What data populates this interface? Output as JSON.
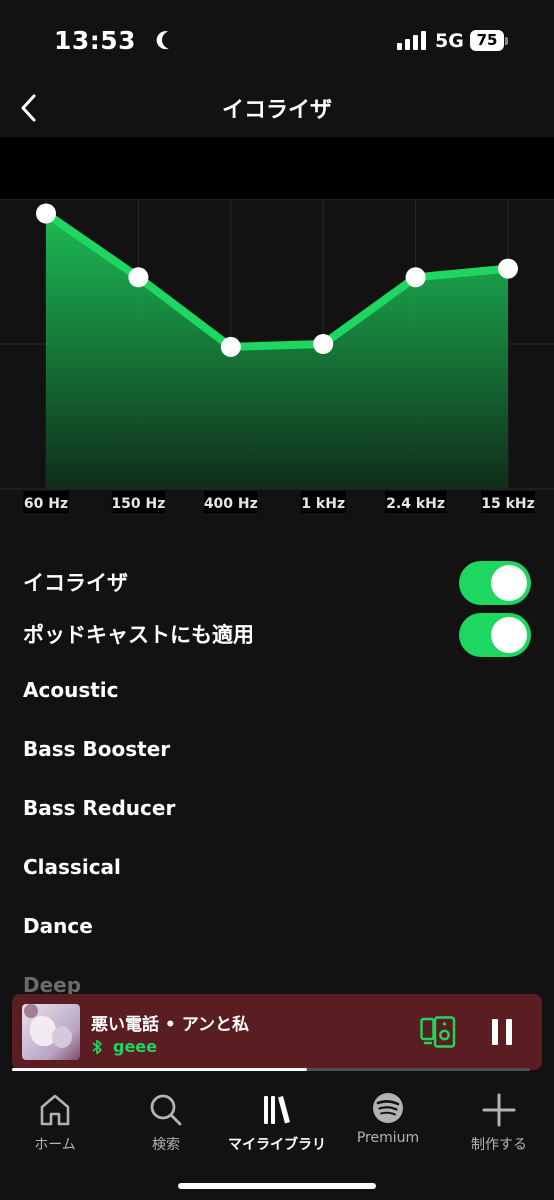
{
  "status_bar": {
    "time": "13:53",
    "network": "5G",
    "battery": "75",
    "icons": [
      "moon-icon",
      "signal-icon",
      "battery-icon"
    ]
  },
  "header": {
    "title": "イコライザ",
    "back_icon": "chevron-left-icon"
  },
  "equalizer": {
    "bands": [
      {
        "label": "60 Hz",
        "level": 0.95
      },
      {
        "label": "150 Hz",
        "level": 0.73
      },
      {
        "label": "400 Hz",
        "level": 0.49
      },
      {
        "label": "1 kHz",
        "level": 0.5
      },
      {
        "label": "2.4 kHz",
        "level": 0.73
      },
      {
        "label": "15 kHz",
        "level": 0.76
      }
    ],
    "accent_color": "#1ed760"
  },
  "toggles": {
    "equalizer": {
      "label": "イコライザ",
      "on": true
    },
    "podcasts": {
      "label": "ポッドキャストにも適用",
      "on": true
    }
  },
  "presets": [
    "Acoustic",
    "Bass Booster",
    "Bass Reducer",
    "Classical",
    "Dance",
    "Deep"
  ],
  "player": {
    "song_title": "悪い電話 • アンと私",
    "device_name": "geee",
    "progress": 0.57,
    "icons": [
      "bluetooth-icon",
      "connect-device-icon",
      "pause-icon"
    ]
  },
  "nav": {
    "home": "ホーム",
    "search": "検索",
    "library": "マイライブラリ",
    "premium": "Premium",
    "create": "制作する"
  }
}
